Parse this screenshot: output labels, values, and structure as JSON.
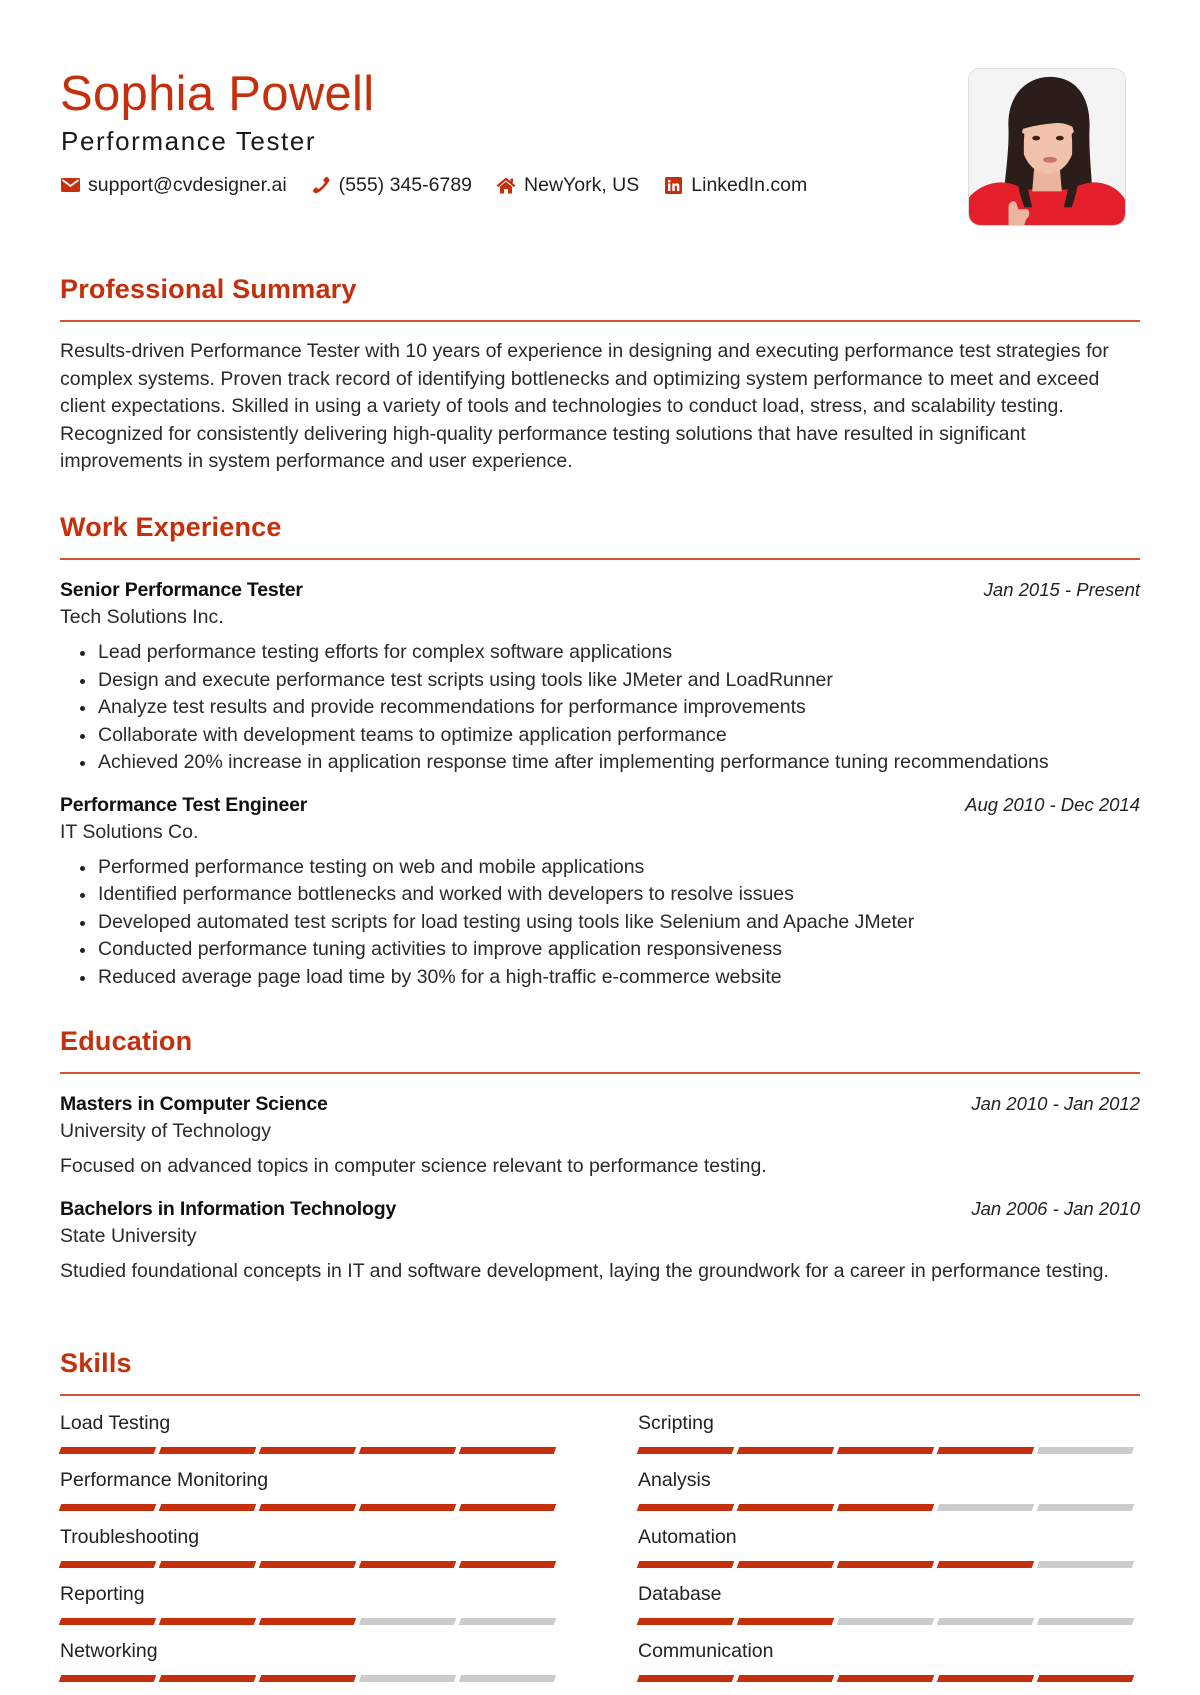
{
  "header": {
    "name": "Sophia Powell",
    "title": "Performance Tester",
    "contacts": [
      {
        "icon": "envelope-icon",
        "text": "support@cvdesigner.ai"
      },
      {
        "icon": "phone-icon",
        "text": "(555) 345-6789"
      },
      {
        "icon": "home-icon",
        "text": "NewYork, US"
      },
      {
        "icon": "linkedin-icon",
        "text": "LinkedIn.com"
      }
    ],
    "photo_alt": "Profile photo"
  },
  "colors": {
    "accent": "#c4300c",
    "rule": "#d2543a",
    "bar_empty": "#cccccc",
    "text": "#222222"
  },
  "summary": {
    "heading": "Professional Summary",
    "text": "Results-driven Performance Tester with 10 years of experience in designing and executing performance test strategies for complex systems. Proven track record of identifying bottlenecks and optimizing system performance to meet and exceed client expectations. Skilled in using a variety of tools and technologies to conduct load, stress, and scalability testing. Recognized for consistently delivering high-quality performance testing solutions that have resulted in significant improvements in system performance and user experience."
  },
  "experience": {
    "heading": "Work Experience",
    "jobs": [
      {
        "title": "Senior Performance Tester",
        "company": "Tech Solutions Inc.",
        "dates": "Jan 2015 - Present",
        "bullets": [
          "Lead performance testing efforts for complex software applications",
          "Design and execute performance test scripts using tools like JMeter and LoadRunner",
          "Analyze test results and provide recommendations for performance improvements",
          "Collaborate with development teams to optimize application performance",
          "Achieved 20% increase in application response time after implementing performance tuning recommendations"
        ]
      },
      {
        "title": "Performance Test Engineer",
        "company": "IT Solutions Co.",
        "dates": "Aug 2010 - Dec 2014",
        "bullets": [
          "Performed performance testing on web and mobile applications",
          "Identified performance bottlenecks and worked with developers to resolve issues",
          "Developed automated test scripts for load testing using tools like Selenium and Apache JMeter",
          "Conducted performance tuning activities to improve application responsiveness",
          "Reduced average page load time by 30% for a high-traffic e-commerce website"
        ]
      }
    ]
  },
  "education": {
    "heading": "Education",
    "entries": [
      {
        "degree": "Masters in Computer Science",
        "school": "University of Technology",
        "dates": "Jan 2010 - Jan 2012",
        "description": "Focused on advanced topics in computer science relevant to performance testing."
      },
      {
        "degree": "Bachelors in Information Technology",
        "school": "State University",
        "dates": "Jan 2006 - Jan 2010",
        "description": "Studied foundational concepts in IT and software development, laying the groundwork for a career in performance testing."
      }
    ]
  },
  "skills": {
    "heading": "Skills",
    "max_level": 5,
    "items": [
      {
        "name": "Load Testing",
        "level": 5
      },
      {
        "name": "Scripting",
        "level": 4
      },
      {
        "name": "Performance Monitoring",
        "level": 5
      },
      {
        "name": "Analysis",
        "level": 3
      },
      {
        "name": "Troubleshooting",
        "level": 5
      },
      {
        "name": "Automation",
        "level": 4
      },
      {
        "name": "Reporting",
        "level": 3
      },
      {
        "name": "Database",
        "level": 2
      },
      {
        "name": "Networking",
        "level": 3
      },
      {
        "name": "Communication",
        "level": 5
      }
    ]
  }
}
